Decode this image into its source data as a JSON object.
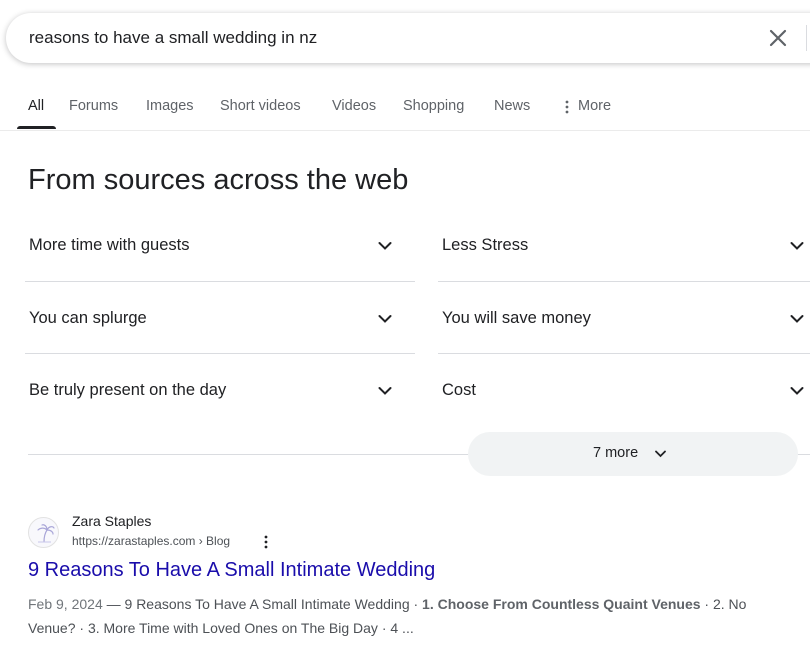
{
  "search": {
    "query": "reasons to have a small wedding in nz",
    "clear_icon": "close-icon"
  },
  "tabs": [
    {
      "label": "All",
      "active": true
    },
    {
      "label": "Forums"
    },
    {
      "label": "Images"
    },
    {
      "label": "Short videos"
    },
    {
      "label": "Videos"
    },
    {
      "label": "Shopping"
    },
    {
      "label": "News"
    },
    {
      "label": "More",
      "icon": "more-vert-icon"
    }
  ],
  "sources": {
    "title": "From sources across the web",
    "items": [
      {
        "label": "More time with guests"
      },
      {
        "label": "Less Stress"
      },
      {
        "label": "You can splurge"
      },
      {
        "label": "You will save money"
      },
      {
        "label": "Be truly present on the day"
      },
      {
        "label": "Cost"
      }
    ],
    "more_label": "7 more"
  },
  "result": {
    "site_name": "Zara Staples",
    "url": "https://zarastaples.com › Blog",
    "title": "9 Reasons To Have A Small Intimate Wedding",
    "date": "Feb 9, 2024",
    "snippet_lead": " — 9 Reasons To Have A Small Intimate Wedding · ",
    "snippet_bold": "1. Choose From Countless Quaint Venues",
    "snippet_tail": " · 2. No Venue? · 3. More Time with Loved Ones on The Big Day · 4 ..."
  },
  "colors": {
    "link": "#1a0dab",
    "text": "#202124",
    "muted": "#5f6368"
  }
}
